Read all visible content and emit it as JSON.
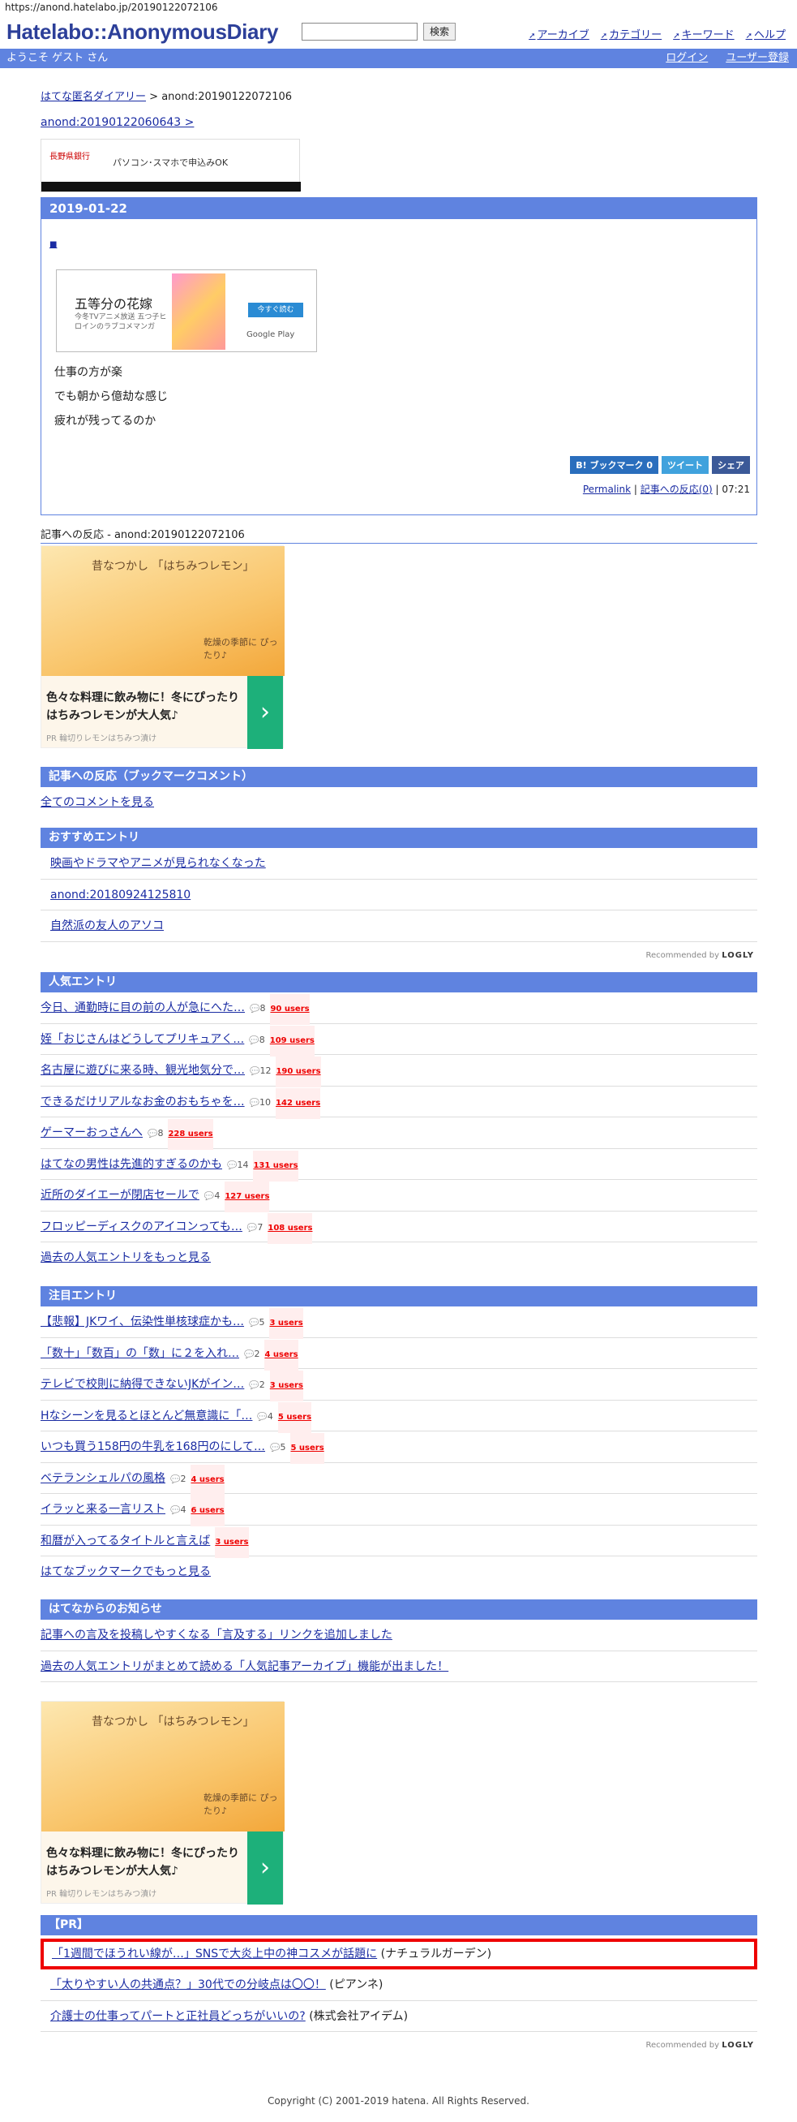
{
  "url": "https://anond.hatelabo.jp/20190122072106",
  "header": {
    "logo": "Hatelabo::AnonymousDiary",
    "search_button": "検索",
    "nav": [
      "アーカイブ",
      "カテゴリー",
      "キーワード",
      "ヘルプ"
    ]
  },
  "bar": {
    "welcome": "ようこそ ゲスト さん",
    "login": "ログイン",
    "register": "ユーザー登録"
  },
  "crumb": {
    "home": "はてな匿名ダイアリー",
    "sep": " > ",
    "current": "anond:20190122072106"
  },
  "prev_link": "anond:20190122060643 >",
  "ad_banner": {
    "t1": "長野県銀行",
    "t2": "パソコン･スマホで申込みOK"
  },
  "entry": {
    "date": "2019-01-22",
    "star": "■",
    "ad_title": "五等分の花嫁",
    "ad_sub": "今冬TVアニメ放送 五つ子ヒロインのラブコメマンガ",
    "ad_btn": "今すぐ読む",
    "ad_store": "Google Play",
    "lines": [
      "仕事の方が楽",
      "でも朝から億劫な感じ",
      "疲れが残ってるのか"
    ],
    "share": [
      "B! ブックマーク 0",
      "ツイート",
      "シェア"
    ],
    "permalink": "Permalink",
    "reactions": "記事への反応(0)",
    "time": " | 07:21"
  },
  "reaction_title": "記事への反応 - anond:20190122072106",
  "bigad": {
    "c1": "昔なつかし 「はちみつレモン」",
    "c2": "乾燥の季節に ぴったり♪",
    "text": "色々な料理に飲み物に！冬にぴったりはちみつレモンが大人気♪",
    "pr": "PR 輪切りレモンはちみつ漬け",
    "arrow": "›"
  },
  "bookmark": {
    "title": "記事への反応（ブックマークコメント）",
    "all": "全てのコメントを見る"
  },
  "osusume": {
    "title": "おすすめエントリ",
    "items": [
      "映画やドラマやアニメが見られなくなった",
      "anond:20180924125810",
      "自然派の友人のアソコ"
    ],
    "rec": "Recommended by",
    "brand": "LOGLY"
  },
  "ninki": {
    "title": "人気エントリ",
    "items": [
      {
        "t": "今日、通勤時に目の前の人が急にへた…",
        "c": "8",
        "u": "90 users"
      },
      {
        "t": "姪「おじさんはどうしてプリキュアく…",
        "c": "8",
        "u": "109 users"
      },
      {
        "t": "名古屋に遊びに来る時、観光地気分で…",
        "c": "12",
        "u": "190 users"
      },
      {
        "t": "できるだけリアルなお金のおもちゃを…",
        "c": "10",
        "u": "142 users"
      },
      {
        "t": "ゲーマーおっさんへ",
        "c": "8",
        "u": "228 users"
      },
      {
        "t": "はてなの男性は先進的すぎるのかも",
        "c": "14",
        "u": "131 users"
      },
      {
        "t": "近所のダイエーが閉店セールで",
        "c": "4",
        "u": "127 users"
      },
      {
        "t": "フロッピーディスクのアイコンっても…",
        "c": "7",
        "u": "108 users"
      }
    ],
    "more": "過去の人気エントリをもっと見る"
  },
  "chumoku": {
    "title": "注目エントリ",
    "items": [
      {
        "t": "【悲報】JKワイ、伝染性単核球症かも…",
        "c": "5",
        "u": "3 users"
      },
      {
        "t": "「数十」「数百」の「数」に２を入れ…",
        "c": "2",
        "u": "4 users"
      },
      {
        "t": "テレビで校則に納得できないJKがイン…",
        "c": "2",
        "u": "3 users"
      },
      {
        "t": "Hなシーンを見るとほとんど無意識に「…",
        "c": "4",
        "u": "5 users"
      },
      {
        "t": "いつも買う158円の牛乳を168円のにして…",
        "c": "5",
        "u": "5 users"
      },
      {
        "t": "ベテランシェルパの風格",
        "c": "2",
        "u": "4 users"
      },
      {
        "t": "イラッと来る一言リスト",
        "c": "4",
        "u": "6 users"
      },
      {
        "t": "和暦が入ってるタイトルと言えば",
        "c": "",
        "u": "3 users"
      }
    ],
    "more": "はてなブックマークでもっと見る"
  },
  "oshirase": {
    "title": "はてなからのお知らせ",
    "items": [
      "記事への言及を投稿しやすくなる「言及する」リンクを追加しました",
      "過去の人気エントリがまとめて読める「人気記事アーカイブ」機能が出ました！"
    ]
  },
  "pr": {
    "title": "【PR】",
    "items": [
      {
        "t": "「1週間でほうれい線が…」SNSで大炎上中の神コスメが話題に",
        "s": "(ナチュラルガーデン)"
      },
      {
        "t": "「太りやすい人の共通点？」30代での分岐点は〇〇！",
        "s": "(ピアンネ)"
      },
      {
        "t": "介護士の仕事ってパートと正社員どっちがいいの?",
        "s": "(株式会社アイデム)"
      }
    ]
  },
  "footer": "Copyright (C) 2001-2019 hatena. All Rights Reserved."
}
